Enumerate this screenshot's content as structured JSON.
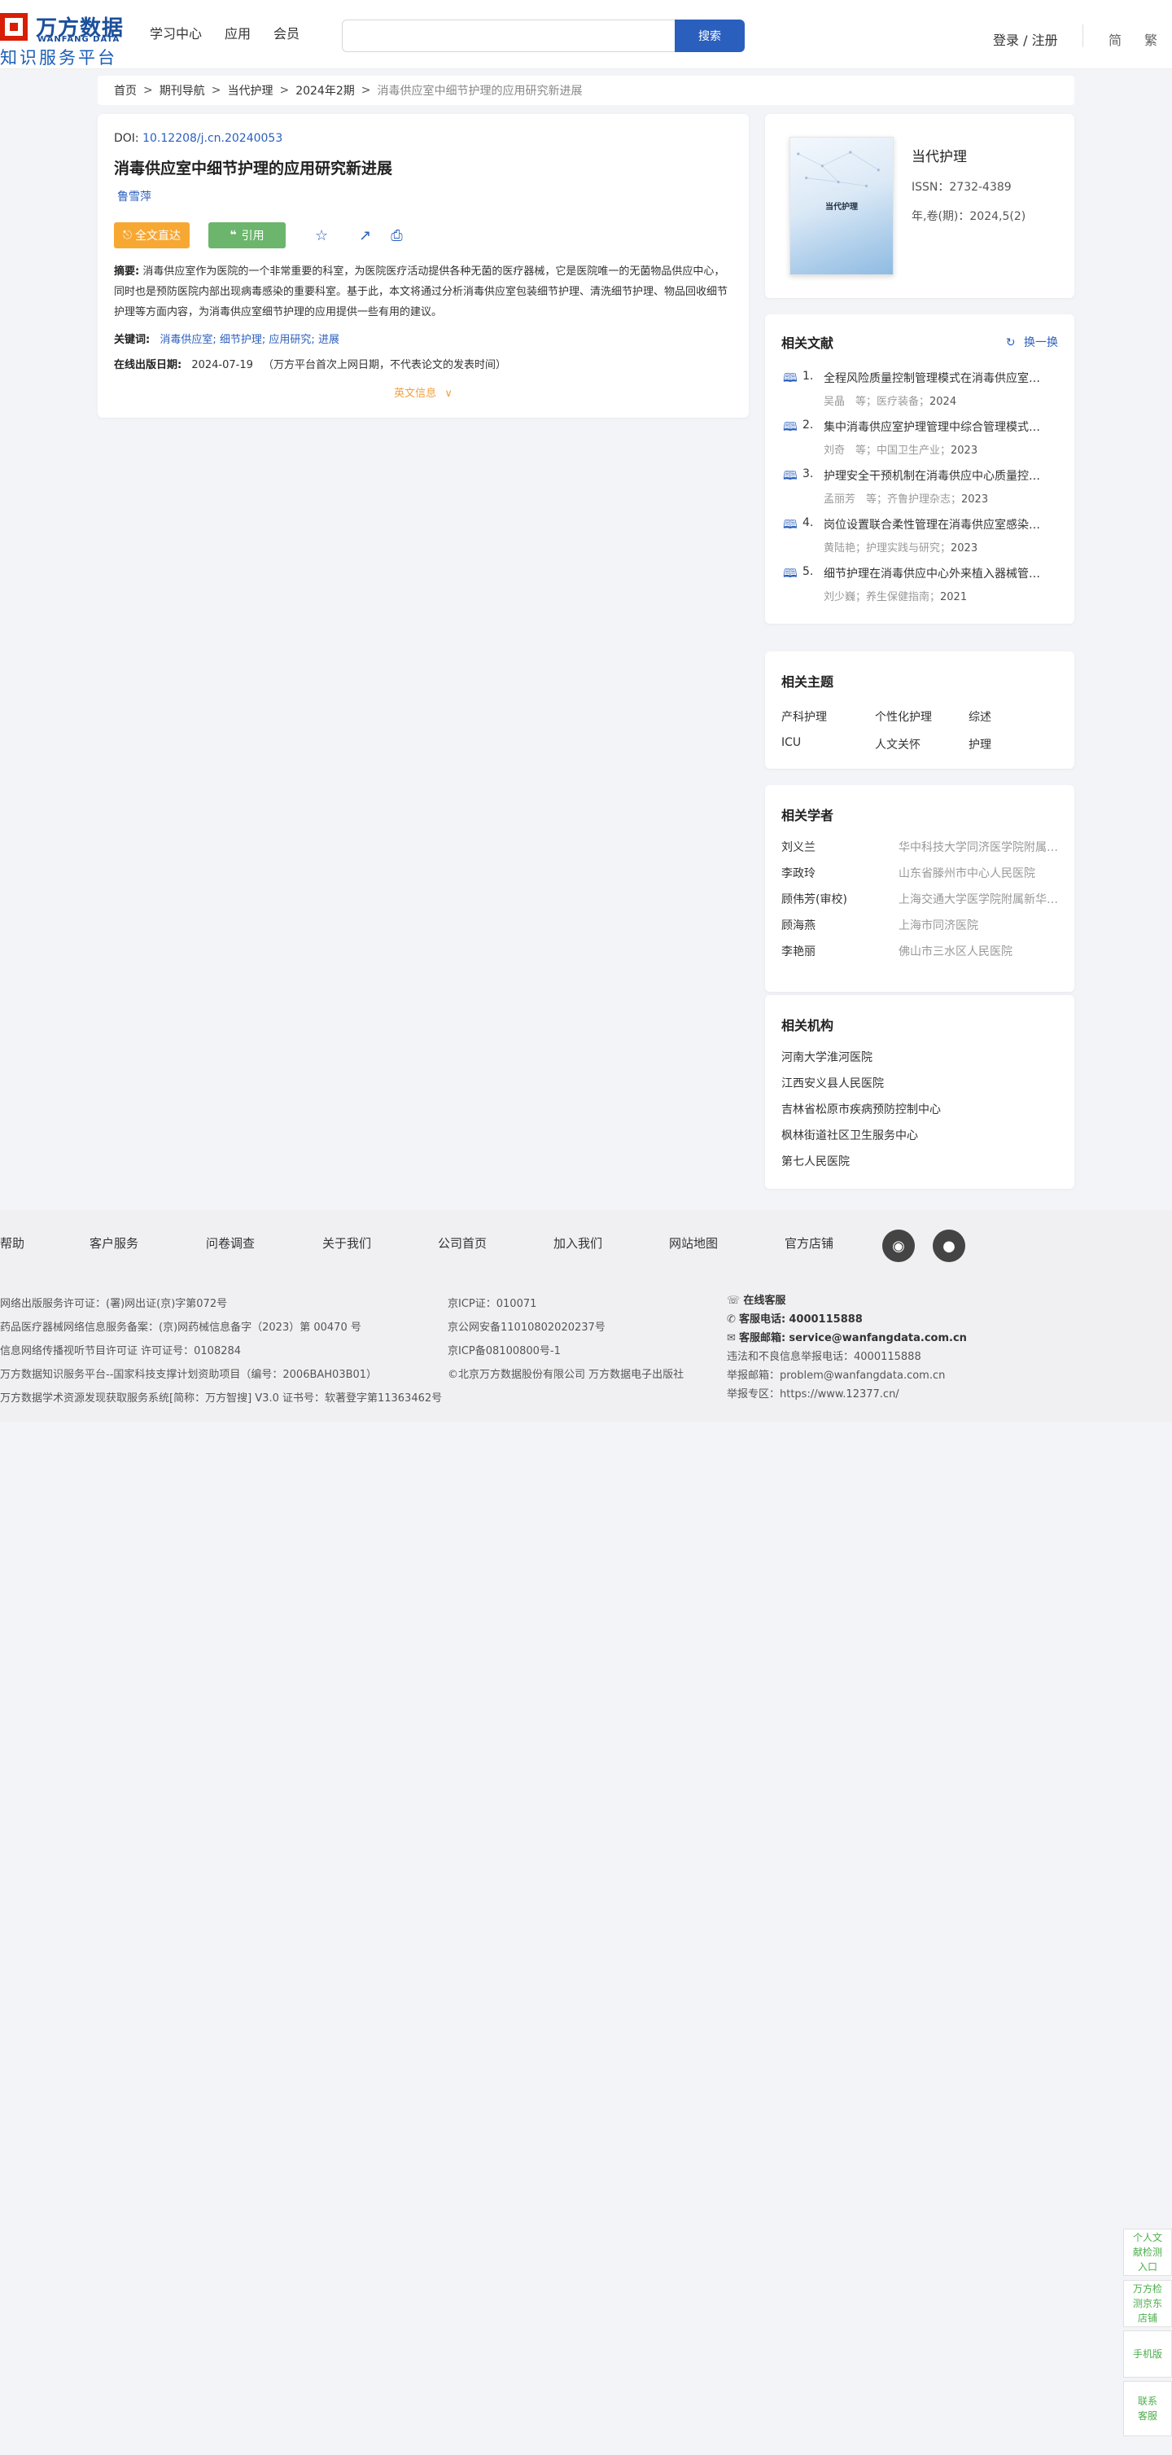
{
  "header": {
    "logo_cn": "万方数据",
    "logo_en": "WANFANG DATA",
    "logo_sub": "知识服务平台",
    "nav": [
      "学习中心",
      "应用",
      "会员"
    ],
    "search_placeholder": "",
    "search_button": "搜索",
    "login": "登录 / 注册",
    "lang_simplified": "简",
    "lang_traditional": "繁"
  },
  "breadcrumb": [
    "首页",
    "期刊导航",
    "当代护理",
    "2024年2期",
    "消毒供应室中细节护理的应用研究新进展"
  ],
  "article": {
    "doi_label": "DOI:",
    "doi_value": "10.12208/j.cn.20240053",
    "title": "消毒供应室中细节护理的应用研究新进展",
    "author": "鲁雪萍",
    "btn_fulltext": "全文直达",
    "btn_cite": "引用",
    "abstract_label": "摘要:",
    "abstract": "消毒供应室作为医院的一个非常重要的科室，为医院医疗活动提供各种无菌的医疗器械，它是医院唯一的无菌物品供应中心，同时也是预防医院内部出现病毒感染的重要科室。基于此，本文将通过分析消毒供应室包装细节护理、清洗细节护理、物品回收细节护理等方面内容，为消毒供应室细节护理的应用提供一些有用的建议。",
    "keywords_label": "关键词:",
    "keywords": [
      "消毒供应室;",
      "细节护理;",
      "应用研究;",
      "进展"
    ],
    "pubdate_label": "在线出版日期:",
    "pubdate": "2024-07-19",
    "pubdate_note": "（万方平台首次上网日期，不代表论文的发表时间）",
    "more_info": "英文信息"
  },
  "journal": {
    "cover_title": "当代护理",
    "name": "当代护理",
    "issn": "ISSN：2732-4389",
    "volume": "年,卷(期)：2024,5(2)"
  },
  "related_docs": {
    "title": "相关文献",
    "swap": "换一换",
    "items": [
      {
        "num": "1.",
        "title": "全程风险质量控制管理模式在消毒供应室中的应用研究",
        "meta": "吴晶　等；医疗装备；",
        "year": "2024"
      },
      {
        "num": "2.",
        "title": "集中消毒供应室护理管理中综合管理模式的应用价值分析",
        "meta": "刘奇　等；中国卫生产业；",
        "year": "2023"
      },
      {
        "num": "3.",
        "title": "护理安全干预机制在消毒供应中心质量控制中的应用效果",
        "meta": "孟丽芳　等；齐鲁护理杂志；",
        "year": "2023"
      },
      {
        "num": "4.",
        "title": "岗位设置联合柔性管理在消毒供应室感染防控中的应用",
        "meta": "黄陆艳；护理实践与研究；",
        "year": "2023"
      },
      {
        "num": "5.",
        "title": "细节护理在消毒供应中心外来植入器械管理中的应用",
        "meta": "刘少巍；养生保健指南；",
        "year": "2021"
      }
    ]
  },
  "topics": {
    "title": "相关主题",
    "items": [
      "产科护理",
      "个性化护理",
      "综述",
      "ICU",
      "人文关怀",
      "护理"
    ]
  },
  "scholars": {
    "title": "相关学者",
    "items": [
      {
        "name": "刘义兰",
        "org": "华中科技大学同济医学院附属协和医院"
      },
      {
        "name": "李政玲",
        "org": "山东省滕州市中心人民医院"
      },
      {
        "name": "顾伟芳(审校)",
        "org": "上海交通大学医学院附属新华医院"
      },
      {
        "name": "顾海燕",
        "org": "上海市同济医院"
      },
      {
        "name": "李艳丽",
        "org": "佛山市三水区人民医院"
      }
    ]
  },
  "orgs": {
    "title": "相关机构",
    "items": [
      "河南大学淮河医院",
      "江西安义县人民医院",
      "吉林省松原市疾病预防控制中心",
      "枫林街道社区卫生服务中心",
      "第七人民医院"
    ]
  },
  "footer": {
    "links": [
      "帮助",
      "客户服务",
      "问卷调查",
      "关于我们",
      "公司首页",
      "加入我们",
      "网站地图",
      "官方店铺"
    ],
    "col1": [
      "网络出版服务许可证：(署)网出证(京)字第072号",
      "药品医疗器械网络信息服务备案：(京)网药械信息备字（2023）第 00470 号",
      "信息网络传播视听节目许可证 许可证号：0108284",
      "万方数据知识服务平台--国家科技支撑计划资助项目（编号：2006BAH03B01）",
      "万方数据学术资源发现获取服务系统[简称：万方智搜] V3.0 证书号：软著登字第11363462号"
    ],
    "col2": [
      "京ICP证：010071",
      "京公网安备11010802020237号",
      "京ICP备08100800号-1",
      "©北京万方数据股份有限公司 万方数据电子出版社"
    ],
    "online_service": "在线客服",
    "phone_label": "客服电话:",
    "phone": "4000115888",
    "email_label": "客服邮箱:",
    "email": "service@wanfangdata.com.cn",
    "col3_extra": [
      "违法和不良信息举报电话：4000115888",
      "举报邮箱：problem@wanfangdata.com.cn",
      "举报专区：https://www.12377.cn/"
    ]
  },
  "float": {
    "detect": "个人文献检测入口",
    "store": "万方检测京东店铺",
    "mobile": "手机版",
    "contact": "联系客服"
  }
}
